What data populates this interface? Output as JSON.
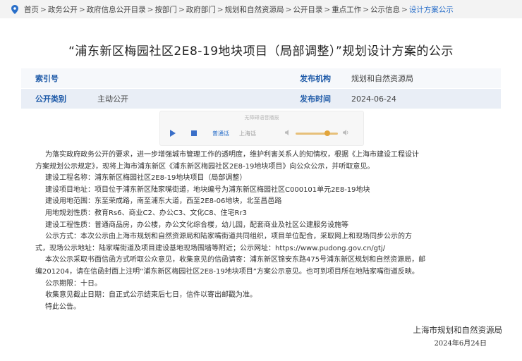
{
  "breadcrumb": [
    "首页",
    "政务公开",
    "政府信息公开目录",
    "按部门",
    "政府部门",
    "规划和自然资源局",
    "公开目录",
    "重点工作",
    "公示信息",
    "设计方案公示"
  ],
  "breadcrumb_sep": ">",
  "title": "“浦东新区梅园社区2E8-19地块项目（局部调整）”规划设计方案的公示",
  "meta": {
    "index_label": "索引号",
    "index_value": "",
    "org_label": "发布机构",
    "org_value": "规划和自然资源局",
    "category_label": "公开类别",
    "category_value": "主动公开",
    "time_label": "发布时间",
    "time_value": "2024-06-24"
  },
  "player": {
    "hint": "无障碍语音播报",
    "lang_mandarin": "普通话",
    "lang_shanghai": "上海话",
    "volume_level": 0.75,
    "accent_color": "#3a6fc8"
  },
  "body": [
    {
      "text": "为落实政府政务公开的要求，进一步增强城市管理工作的透明度，维护利害关系人的知情权，根据《上海市建设工程设计",
      "indent": true
    },
    {
      "text": "方案规划公示规定》，现将上海市浦东新区《浦东新区梅园社区2E8-19地块项目》向公众公示，并听取意见。",
      "indent": false
    },
    {
      "text": "建设工程名称：浦东新区梅园社区2E8-19地块项目（局部调整）",
      "indent": true
    },
    {
      "text": "建设项目地址：项目位于浦东新区陆家嘴街道，地块编号为浦东新区梅园社区C000101单元2E8-19地块",
      "indent": true
    },
    {
      "text": "建设用地范围：东至荣成路，南至浦东大道，西至2E8-06地块，北至昌邑路",
      "indent": true
    },
    {
      "text": "用地规划性质：教育Rs6、商业C2、办公C3、文化C8、住宅Rr3",
      "indent": true
    },
    {
      "text": "建设工程性质：普通商品房，办公楼，办公文化综合楼，幼儿园，配套商业及社区公建服务设施等",
      "indent": true
    },
    {
      "text": "公示方式：本次公示由上海市规划和自然资源局和陆家嘴街道共同组织，项目单位配合，采取网上和现场同步公示的方",
      "indent": true
    },
    {
      "text": "式，现场公示地址：陆家嘴街道及项目建设基地现场围墙等附近；公示网址：https://www.pudong.gov.cn/gtj/",
      "indent": false
    },
    {
      "text": "本次公示采取书面信函方式听取公众意见，收集意见的信函请寄：浦东新区锦安东路475号浦东新区规划和自然资源局，邮",
      "indent": true
    },
    {
      "text": "编201204，请在信函封面上注明“浦东新区梅园社区2E8-19地块项目”方案公示意见。也可到项目所在地陆家嘴街道反映。",
      "indent": false
    },
    {
      "text": "公示期限：十日。",
      "indent": true
    },
    {
      "text": "收集意见截止日期：自正式公示结束后七日，信件以寄出邮戳为准。",
      "indent": true
    },
    {
      "text": "特此公告。",
      "indent": true
    }
  ],
  "signature": "上海市规划和自然资源局",
  "sign_date": "2024年6月24日",
  "colors": {
    "link": "#2a6fc9",
    "label": "#1e5aa8",
    "row_alt": "#e9eef6"
  }
}
